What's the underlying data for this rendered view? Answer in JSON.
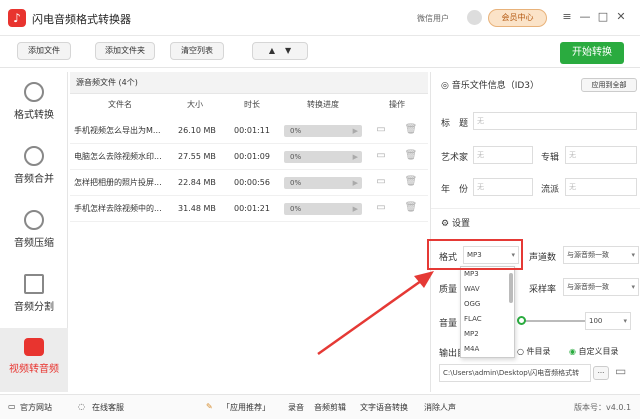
{
  "app": {
    "title": "闪电音频格式转换器",
    "wechat_user": "微信用户",
    "vip_label": "会员中心"
  },
  "toolbar": {
    "add_file": "添加文件",
    "add_folder": "添加文件夹",
    "clear_list": "清空列表",
    "up": "▲",
    "down": "▼",
    "start": "开始转换"
  },
  "sidebar": {
    "items": [
      {
        "label": "格式转换"
      },
      {
        "label": "音频合并"
      },
      {
        "label": "音频压缩"
      },
      {
        "label": "音频分割"
      },
      {
        "label": "视频转音频"
      }
    ]
  },
  "files": {
    "header": "源音频文件 (4个)",
    "columns": [
      "文件名",
      "大小",
      "时长",
      "转换进度",
      "操作"
    ],
    "rows": [
      {
        "name": "手机视频怎么导出为M...",
        "size": "26.10 MB",
        "duration": "00:01:11",
        "progress": "0%"
      },
      {
        "name": "电脑怎么去除视频水印...",
        "size": "27.55 MB",
        "duration": "00:01:09",
        "progress": "0%"
      },
      {
        "name": "怎样把相册的照片投屏...",
        "size": "22.84 MB",
        "duration": "00:00:56",
        "progress": "0%"
      },
      {
        "name": "手机怎样去除视频中的...",
        "size": "31.48 MB",
        "duration": "00:01:21",
        "progress": "0%"
      }
    ]
  },
  "id3": {
    "title": "音乐文件信息（ID3）",
    "apply_all": "应用到全部",
    "labels": {
      "title": "标　题",
      "artist": "艺术家",
      "album": "专辑",
      "year": "年　份",
      "genre": "流派"
    },
    "placeholder": "无"
  },
  "settings": {
    "title": "设置",
    "format_label": "格式",
    "format_value": "MP3",
    "channel_label": "声道数",
    "channel_value": "与源音频一致",
    "quality_label": "质量",
    "samplerate_label": "采样率",
    "samplerate_value": "与源音频一致",
    "volume_label": "音量",
    "volume_value": "100",
    "output_label": "输出目",
    "output_opt1": "件目录",
    "output_opt2": "自定义目录",
    "path": "C:\\Users\\admin\\Desktop\\闪电音频格式转"
  },
  "dropdown": {
    "options": [
      "MP3",
      "WAV",
      "OGG",
      "FLAC",
      "MP2",
      "M4A"
    ]
  },
  "statusbar": {
    "website": "官方网站",
    "online": "在线客服",
    "recommend": "「应用推荐」",
    "record": "录音",
    "audio_edit": "音频剪辑",
    "tts": "文字语音转换",
    "vocal": "消除人声",
    "version": "版本号：v4.0.1"
  },
  "colors": {
    "accent": "#e8342f",
    "start": "#2aab3f"
  }
}
